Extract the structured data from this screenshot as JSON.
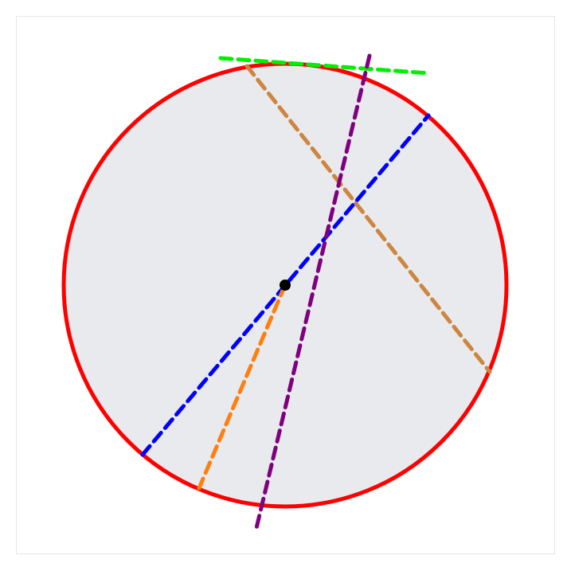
{
  "diagram": {
    "circle": {
      "fill": "#e8eaed",
      "stroke": "#ff0000"
    },
    "center_point": {
      "color": "#000000"
    },
    "lines": [
      {
        "role": "tangent",
        "color": "#00ee00"
      },
      {
        "role": "diameter",
        "color": "#0000ff"
      },
      {
        "role": "radius",
        "color": "#ff7f0e"
      },
      {
        "role": "chord",
        "color": "#cd853f"
      },
      {
        "role": "secant",
        "color": "#800080"
      }
    ]
  }
}
